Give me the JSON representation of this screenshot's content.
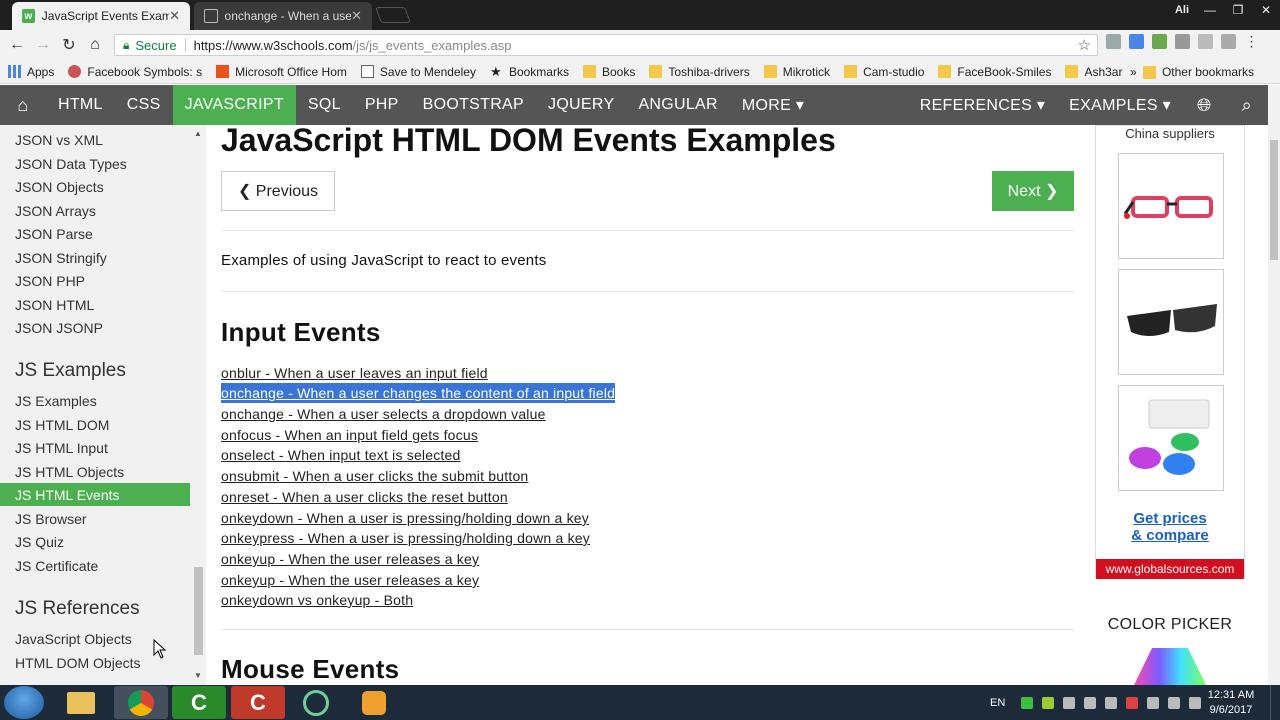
{
  "browser": {
    "tabs": [
      {
        "title": "JavaScript Events Exampl",
        "active": true
      },
      {
        "title": "onchange - When a user",
        "active": false
      }
    ],
    "user_chip": "Ali",
    "secure_label": "Secure",
    "url_host": "https://www.w3schools.com",
    "url_path": "/js/js_events_examples.asp",
    "bookmarks": [
      {
        "label": "Apps",
        "icon": "apps-grid-icon"
      },
      {
        "label": "Facebook Symbols: s",
        "icon": "facebook-symbols-icon"
      },
      {
        "label": "Microsoft Office Hom",
        "icon": "office-icon"
      },
      {
        "label": "Save to Mendeley",
        "icon": "page-icon"
      },
      {
        "label": "Bookmarks",
        "icon": "star-icon"
      },
      {
        "label": "Books",
        "icon": "folder-icon"
      },
      {
        "label": "Toshiba-drivers",
        "icon": "folder-icon"
      },
      {
        "label": "Mikrotick",
        "icon": "folder-icon"
      },
      {
        "label": "Cam-studio",
        "icon": "folder-icon"
      },
      {
        "label": "FaceBook-Smiles",
        "icon": "folder-icon"
      },
      {
        "label": "Ash3ar",
        "icon": "folder-icon"
      }
    ],
    "bookmarks_more": "»",
    "other_bookmarks": "Other bookmarks"
  },
  "nav": {
    "items": [
      "HTML",
      "CSS",
      "JAVASCRIPT",
      "SQL",
      "PHP",
      "BOOTSTRAP",
      "JQUERY",
      "ANGULAR",
      "MORE ▾"
    ],
    "active": "JAVASCRIPT",
    "references": "REFERENCES ▾",
    "examples": "EXAMPLES ▾"
  },
  "sidebar": {
    "json_links": [
      "JSON vs XML",
      "JSON Data Types",
      "JSON Objects",
      "JSON Arrays",
      "JSON Parse",
      "JSON Stringify",
      "JSON PHP",
      "JSON HTML",
      "JSON JSONP"
    ],
    "examples_heading": "JS Examples",
    "examples_links": [
      "JS Examples",
      "JS HTML DOM",
      "JS HTML Input",
      "JS HTML Objects",
      "JS HTML Events",
      "JS Browser",
      "JS Quiz",
      "JS Certificate"
    ],
    "active_link": "JS HTML Events",
    "references_heading": "JS References",
    "references_links": [
      "JavaScript Objects",
      "HTML DOM Objects"
    ]
  },
  "main": {
    "title": "JavaScript HTML DOM Events Examples",
    "prev_label": "❮ Previous",
    "next_label": "Next ❯",
    "intro": "Examples of using JavaScript to react to events",
    "input_heading": "Input Events",
    "input_links": [
      "onblur - When a user leaves an input field",
      "onchange - When a user changes the content of an input field",
      "onchange - When a user selects a dropdown value",
      "onfocus - When an input field gets focus",
      "onselect - When input text is selected",
      "onsubmit - When a user clicks the submit button",
      "onreset - When a user clicks the reset button",
      "onkeydown - When a user is pressing/holding down a key",
      "onkeypress - When a user is pressing/holding down a key",
      "onkeyup - When the user releases a key",
      "onkeyup - When the user releases a key",
      "onkeydown vs onkeyup - Both"
    ],
    "selected_index": 1,
    "mouse_heading": "Mouse Events"
  },
  "ad": {
    "title": "China suppliers",
    "cta_line1": "Get prices",
    "cta_line2": "& compare",
    "footer": "www.globalsources.com"
  },
  "color_picker_label": "COLOR PICKER",
  "taskbar": {
    "language": "EN",
    "time": "12:31 AM",
    "date": "9/6/2017"
  },
  "colors": {
    "w3_green": "#4caf50",
    "w3_nav": "#555555",
    "selection": "#3875d7",
    "ad_red": "#d10f1f"
  }
}
